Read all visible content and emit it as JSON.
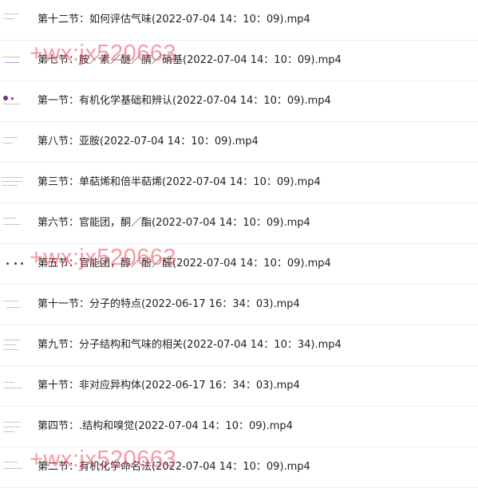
{
  "files": [
    {
      "name": "第十二节：如何评估气味(2022-07-04 14：10：09).mp4"
    },
    {
      "name": "第七节：胺／素／醚／腈／硝基(2022-07-04 14：10：09).mp4"
    },
    {
      "name": "第一节：有机化学基础和辨认(2022-07-04 14：10：09).mp4"
    },
    {
      "name": "第八节：亚胺(2022-07-04 14：10：09).mp4"
    },
    {
      "name": "第三节：单萜烯和倍半萜烯(2022-07-04 14：10：09).mp4"
    },
    {
      "name": "第六节：官能团，酮／酯(2022-07-04 14：10：09).mp4"
    },
    {
      "name": "第五节：官能团，醇／酚／醛(2022-07-04 14：10：09).mp4"
    },
    {
      "name": "第十一节：分子的特点(2022-06-17 16：34：03).mp4"
    },
    {
      "name": "第九节：分子结构和气味的相关(2022-07-04 14：10：34).mp4"
    },
    {
      "name": "第十节：非对应异构体(2022-06-17 16：34：03).mp4"
    },
    {
      "name": "第四节：.结构和嗅觉(2022-07-04 14：10：09).mp4"
    },
    {
      "name": "第二节：有机化学命名法(2022-07-04 14：10：09).mp4"
    }
  ],
  "watermark": {
    "text": "+wx:jx520663",
    "color": "#ee465a"
  }
}
